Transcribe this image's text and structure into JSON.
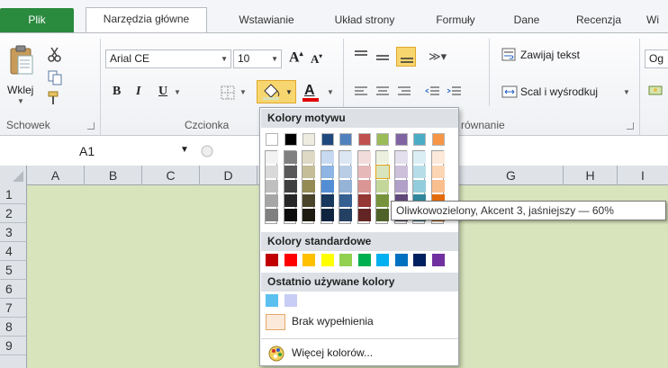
{
  "tabs": [
    {
      "label": "Plik"
    },
    {
      "label": "Narzędzia główne"
    },
    {
      "label": "Wstawianie"
    },
    {
      "label": "Układ strony"
    },
    {
      "label": "Formuły"
    },
    {
      "label": "Dane"
    },
    {
      "label": "Recenzja"
    },
    {
      "label": "Wi"
    }
  ],
  "clipboard": {
    "paste_label": "Wklej",
    "group_label": "Schowek"
  },
  "font": {
    "name": "Arial CE",
    "size": "10",
    "group_label": "Czcionka",
    "bold": "B",
    "italic": "I",
    "underline": "U"
  },
  "alignment": {
    "wrap_label": "Zawijaj tekst",
    "merge_label": "Scal i wyśrodkuj",
    "group_label": "równanie"
  },
  "number": {
    "format_partial": "Og"
  },
  "namebox": {
    "value": "A1"
  },
  "columns": [
    "A",
    "B",
    "C",
    "D",
    "E",
    "F",
    "G",
    "H",
    "I"
  ],
  "rows": [
    "1",
    "2",
    "3",
    "4",
    "5",
    "6",
    "7",
    "8",
    "9"
  ],
  "dropdown": {
    "theme_header": "Kolory motywu",
    "standard_header": "Kolory standardowe",
    "recent_header": "Ostatnio używane kolory",
    "no_fill_label": "Brak wypełnienia",
    "more_colors_label": "Więcej kolorów...",
    "theme_colors": [
      "#ffffff",
      "#000000",
      "#eeece1",
      "#1f497d",
      "#4f81bd",
      "#c0504d",
      "#9bbb59",
      "#8064a2",
      "#4bacc6",
      "#f79646"
    ],
    "theme_shades": [
      [
        "#f2f2f2",
        "#d9d9d9",
        "#bfbfbf",
        "#a6a6a6",
        "#808080"
      ],
      [
        "#808080",
        "#595959",
        "#404040",
        "#262626",
        "#0d0d0d"
      ],
      [
        "#ddd9c4",
        "#c4bd97",
        "#948a54",
        "#4a452a",
        "#1e1c11"
      ],
      [
        "#c6d9f1",
        "#8db4e3",
        "#538ed5",
        "#17375d",
        "#0f243e"
      ],
      [
        "#dce6f2",
        "#b9cde5",
        "#95b3d7",
        "#366092",
        "#244062"
      ],
      [
        "#f2dcdb",
        "#e6b9b8",
        "#da9694",
        "#953735",
        "#632523"
      ],
      [
        "#ebf1de",
        "#d8e4bc",
        "#c4d79b",
        "#76933c",
        "#4f6228"
      ],
      [
        "#e4dfec",
        "#ccc0da",
        "#b1a0c7",
        "#60497a",
        "#403151"
      ],
      [
        "#daeef3",
        "#b7dee8",
        "#92cddc",
        "#31869b",
        "#215967"
      ],
      [
        "#fde9d9",
        "#fcd5b4",
        "#fabf8f",
        "#e26b0a",
        "#974706"
      ]
    ],
    "standard_colors": [
      "#c00000",
      "#ff0000",
      "#ffc000",
      "#ffff00",
      "#92d050",
      "#00b050",
      "#00b0f0",
      "#0070c0",
      "#002060",
      "#7030a0"
    ],
    "recent_colors": [
      "#5bc0f0",
      "#c8cdf5"
    ]
  },
  "tooltip": {
    "text": "Oliwkowozielony, Akcent 3, jaśniejszy — 60%"
  },
  "colors": {
    "grid_fill": "#d8e4bc",
    "file_tab": "#2a8a3e",
    "selection_highlight": "#f8d66f"
  }
}
